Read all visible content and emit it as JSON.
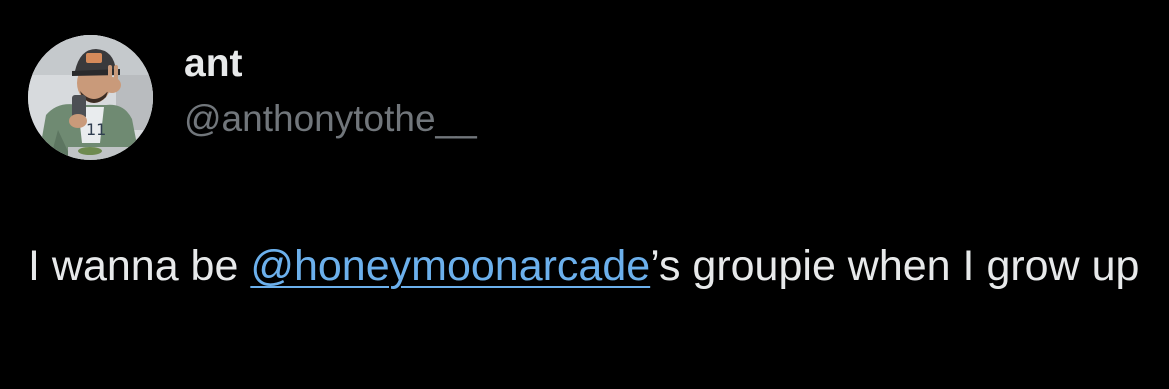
{
  "colors": {
    "background": "#000000",
    "text_primary": "#e7e9ea",
    "text_secondary": "#71767b",
    "mention": "#6cb0ec"
  },
  "author": {
    "display_name": "ant",
    "handle": "@anthonytothe__",
    "avatar_icon": "profile-photo"
  },
  "tweet": {
    "text_before": "I wanna be ",
    "mention": "@honeymoonarcade",
    "text_after": "’s groupie when I grow up"
  }
}
